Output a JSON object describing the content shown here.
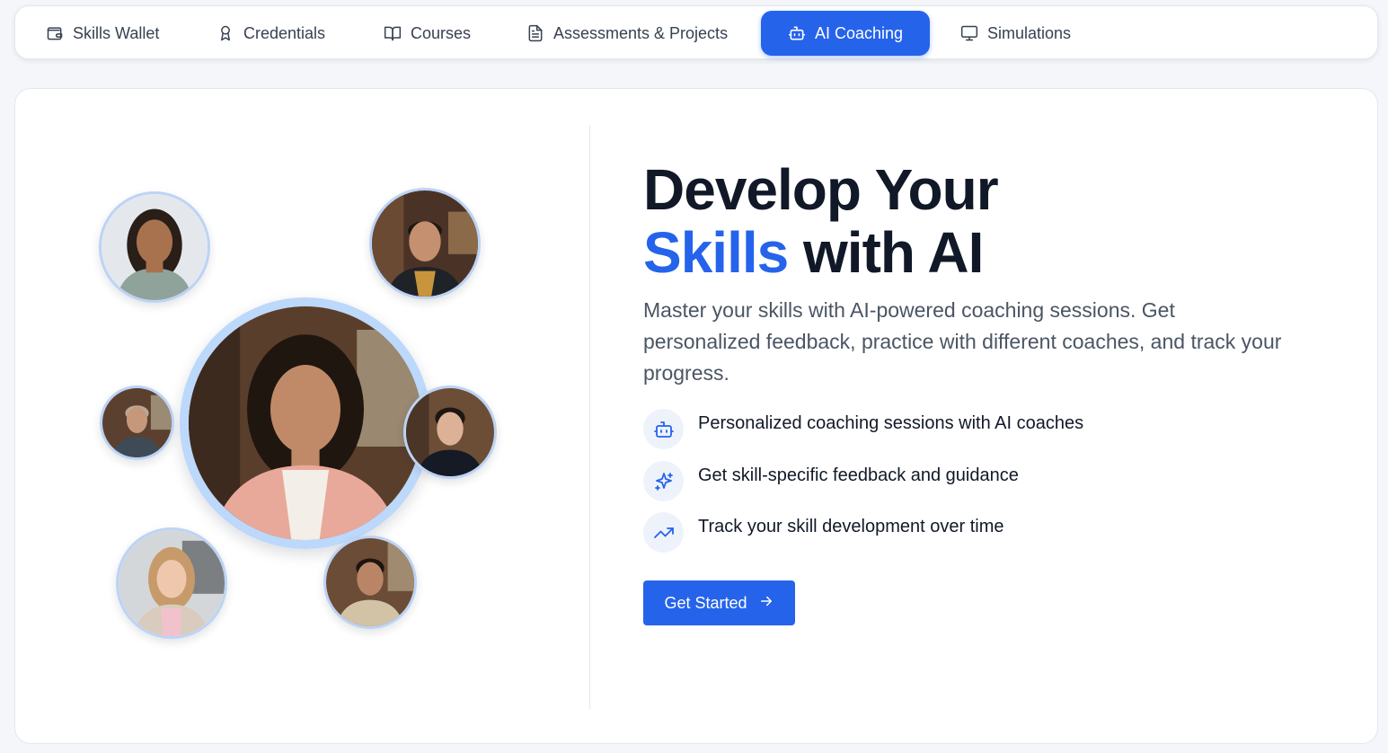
{
  "tabs": [
    {
      "label": "Skills Wallet",
      "icon": "wallet-icon",
      "active": false
    },
    {
      "label": "Credentials",
      "icon": "award-icon",
      "active": false
    },
    {
      "label": "Courses",
      "icon": "book-open-icon",
      "active": false
    },
    {
      "label": "Assessments & Projects",
      "icon": "document-icon",
      "active": false
    },
    {
      "label": "AI Coaching",
      "icon": "bot-icon",
      "active": true
    },
    {
      "label": "Simulations",
      "icon": "monitor-icon",
      "active": false
    }
  ],
  "hero": {
    "title_line1": "Develop Your",
    "title_accent": "Skills",
    "title_rest": "with AI",
    "description": "Master your skills with AI-powered coaching sessions. Get personalized feedback, practice with different coaches, and track your progress.",
    "features": [
      {
        "icon": "bot-icon",
        "text": "Personalized coaching sessions with AI coaches"
      },
      {
        "icon": "sparkles-icon",
        "text": "Get skill-specific feedback and guidance"
      },
      {
        "icon": "trending-up-icon",
        "text": "Track your skill development over time"
      }
    ],
    "cta_label": "Get Started",
    "cta_icon": "arrow-right-icon"
  },
  "colors": {
    "accent": "#2563eb",
    "avatar_ring": "#bcd8fb",
    "page_bg": "#f4f6f9"
  }
}
